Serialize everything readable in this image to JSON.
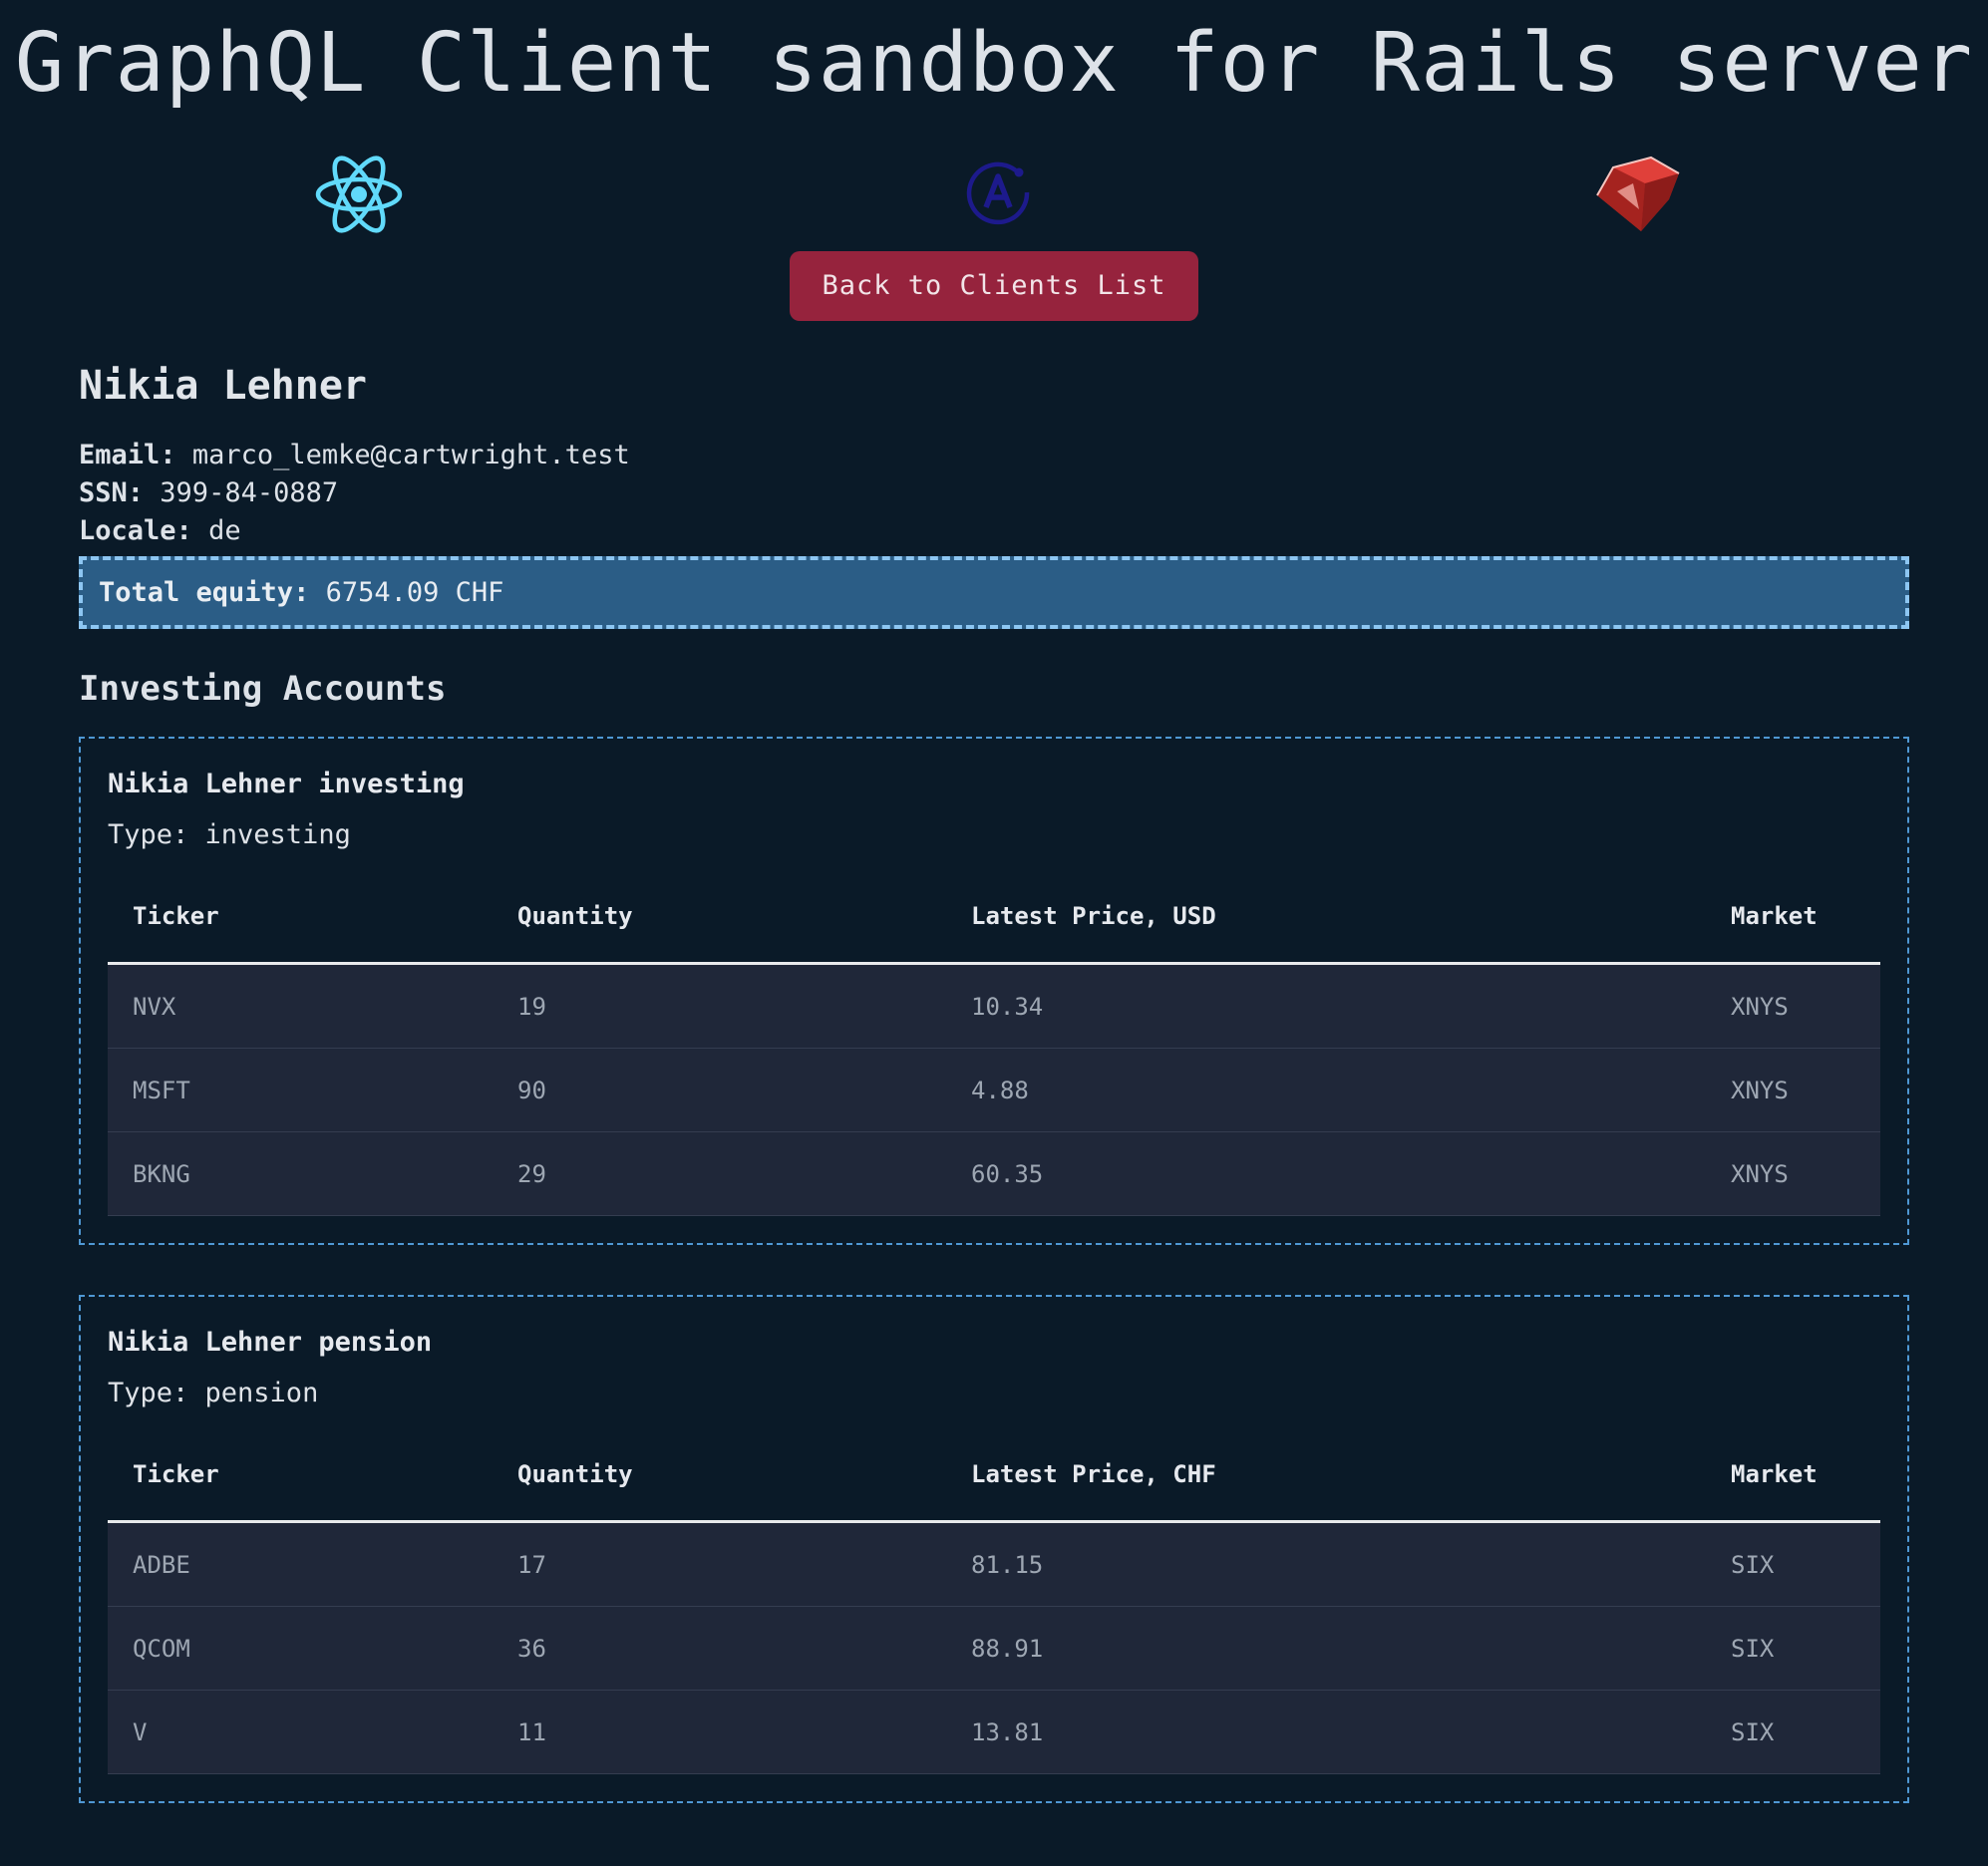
{
  "header": {
    "title": "GraphQL Client sandbox for Rails server",
    "logos": [
      {
        "icon": "react-icon",
        "color": "#61dafb"
      },
      {
        "icon": "apollo-icon",
        "color": "#1d1a8c"
      },
      {
        "icon": "ruby-icon",
        "color": "#c8302c"
      }
    ],
    "back_button_label": "Back to Clients List"
  },
  "client": {
    "name": "Nikia Lehner",
    "email_label": "Email:",
    "email": "marco_lemke@cartwright.test",
    "ssn_label": "SSN:",
    "ssn": "399-84-0887",
    "locale_label": "Locale:",
    "locale": "de",
    "equity_label": "Total equity:",
    "equity": "6754.09 CHF"
  },
  "accounts_title": "Investing Accounts",
  "accounts": [
    {
      "name": "Nikia Lehner investing",
      "type_text": "Type: investing",
      "columns": [
        "Ticker",
        "Quantity",
        "Latest Price, USD",
        "Market"
      ],
      "rows": [
        [
          "NVX",
          "19",
          "10.34",
          "XNYS"
        ],
        [
          "MSFT",
          "90",
          "4.88",
          "XNYS"
        ],
        [
          "BKNG",
          "29",
          "60.35",
          "XNYS"
        ]
      ]
    },
    {
      "name": "Nikia Lehner pension",
      "type_text": "Type: pension",
      "columns": [
        "Ticker",
        "Quantity",
        "Latest Price, CHF",
        "Market"
      ],
      "rows": [
        [
          "ADBE",
          "17",
          "81.15",
          "SIX"
        ],
        [
          "QCOM",
          "36",
          "88.91",
          "SIX"
        ],
        [
          "V",
          "11",
          "13.81",
          "SIX"
        ]
      ]
    }
  ],
  "colors": {
    "background": "#0a1a28",
    "button": "#96233d",
    "equity_box": "#2b5d86",
    "card_border": "#4f98d4"
  }
}
